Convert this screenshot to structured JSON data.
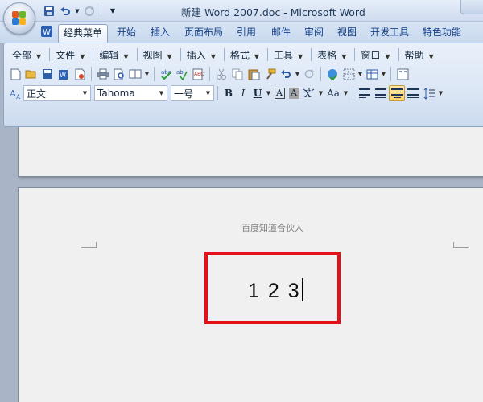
{
  "window": {
    "title": "新建 Word 2007.doc - Microsoft Word"
  },
  "quick_access": {
    "items": [
      "save-icon",
      "undo-icon",
      "redo-icon",
      "customize-icon"
    ]
  },
  "ribbon_tabs": [
    {
      "label": "经典菜单",
      "active": true
    },
    {
      "label": "开始"
    },
    {
      "label": "插入"
    },
    {
      "label": "页面布局"
    },
    {
      "label": "引用"
    },
    {
      "label": "邮件"
    },
    {
      "label": "审阅"
    },
    {
      "label": "视图"
    },
    {
      "label": "开发工具"
    },
    {
      "label": "特色功能"
    }
  ],
  "classic_menu": [
    {
      "label": "全部"
    },
    {
      "label": "文件"
    },
    {
      "label": "编辑"
    },
    {
      "label": "视图"
    },
    {
      "label": "插入"
    },
    {
      "label": "格式"
    },
    {
      "label": "工具"
    },
    {
      "label": "表格"
    },
    {
      "label": "窗口"
    },
    {
      "label": "帮助"
    }
  ],
  "format_bar": {
    "style": "正文",
    "font": "Tahoma",
    "size": "一号",
    "bold": "B",
    "italic": "I",
    "underline": "U",
    "char_border": "A",
    "char_shading": "A",
    "case": "Aa"
  },
  "document": {
    "header": "百度知道合伙人",
    "content": "1 2 3",
    "highlight_color": "#e3121a"
  },
  "colors": {
    "ribbon_bg": "#dbe6f5",
    "tab_text": "#15428b",
    "workspace": "#a9b5c6",
    "page": "#f0f0f0"
  }
}
